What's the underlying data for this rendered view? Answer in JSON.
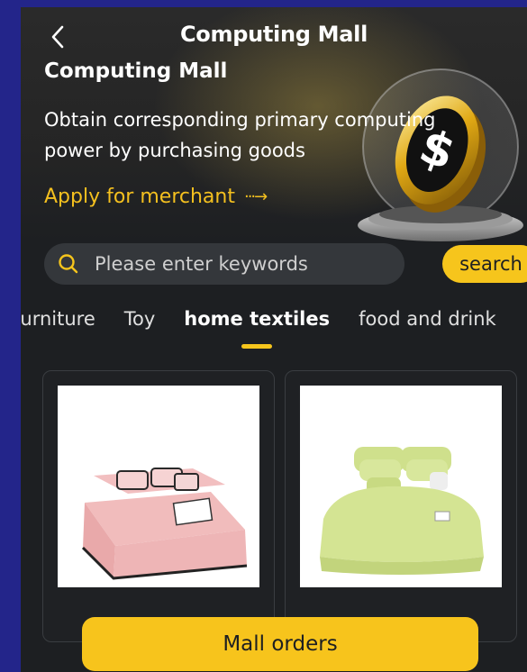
{
  "header": {
    "title": "Computing Mall"
  },
  "hero": {
    "heading": "Computing Mall",
    "description": "Obtain corresponding primary computing power by purchasing goods",
    "apply_label": "Apply for merchant",
    "apply_arrow": "···→"
  },
  "search": {
    "placeholder": "Please enter keywords",
    "button_label": "search"
  },
  "tabs": [
    {
      "label": "furniture"
    },
    {
      "label": "Toy"
    },
    {
      "label": "home textiles",
      "active": true
    },
    {
      "label": "food and drink"
    }
  ],
  "products": [
    {
      "image": "pink bedding set"
    },
    {
      "image": "green bedding set"
    }
  ],
  "footer": {
    "button_label": "Mall orders"
  },
  "colors": {
    "accent": "#f6c51c",
    "background": "#1d1f22",
    "frame": "#23258a"
  }
}
